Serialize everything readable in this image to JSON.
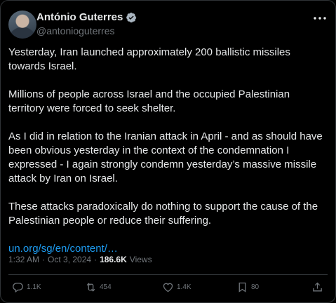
{
  "author": {
    "name": "António Guterres",
    "handle": "@antonioguterres"
  },
  "post": {
    "paragraphs": [
      "Yesterday, Iran launched approximately 200 ballistic missiles towards Israel.",
      "Millions of people across Israel and the occupied Palestinian territory were forced to seek shelter.",
      "As I did in relation to the Iranian attack in April - and as should have been obvious yesterday in the context of the condemnation I expressed - I again strongly condemn yesterday’s massive missile attack by Iran on Israel.",
      "These attacks paradoxically do nothing to support the cause of the Palestinian people or reduce their suffering."
    ],
    "link": "un.org/sg/en/content/…"
  },
  "meta": {
    "time": "1:32 AM",
    "separator": "·",
    "date": "Oct 3, 2024",
    "views_count": "186.6K",
    "views_label": "Views"
  },
  "actions": {
    "replies": "1.1K",
    "reposts": "454",
    "likes": "1.4K",
    "bookmarks": "80"
  },
  "colors": {
    "background": "#000000",
    "text": "#e7e9ea",
    "muted": "#71767b",
    "link": "#1d9bf0",
    "border": "#2f3336"
  }
}
